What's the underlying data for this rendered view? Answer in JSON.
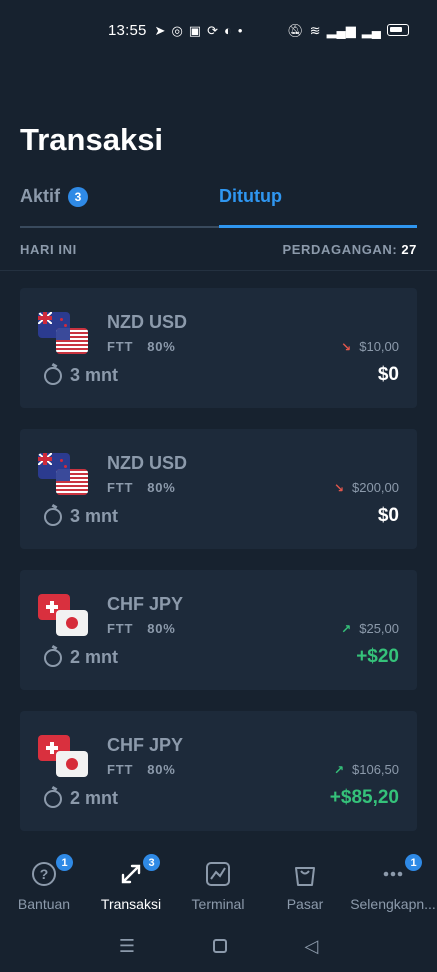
{
  "status_bar": {
    "time": "13:55"
  },
  "header": {
    "title": "Transaksi"
  },
  "tabs": {
    "active_label": "Aktif",
    "active_badge": "3",
    "closed_label": "Ditutup"
  },
  "summary": {
    "left": "HARI INI",
    "right_label": "PERDAGANGAN:",
    "right_count": "27"
  },
  "trades": [
    {
      "pair": "NZD USD",
      "type": "FTT",
      "percent": "80%",
      "direction": "down",
      "amount": "$10,00",
      "duration": "3 mnt",
      "profit": "$0",
      "flags": [
        "nz",
        "us"
      ]
    },
    {
      "pair": "NZD USD",
      "type": "FTT",
      "percent": "80%",
      "direction": "down",
      "amount": "$200,00",
      "duration": "3 mnt",
      "profit": "$0",
      "flags": [
        "nz",
        "us"
      ]
    },
    {
      "pair": "CHF JPY",
      "type": "FTT",
      "percent": "80%",
      "direction": "up",
      "amount": "$25,00",
      "duration": "2 mnt",
      "profit": "+$20",
      "flags": [
        "ch",
        "jp"
      ]
    },
    {
      "pair": "CHF JPY",
      "type": "FTT",
      "percent": "80%",
      "direction": "up",
      "amount": "$106,50",
      "duration": "2 mnt",
      "profit": "+$85,20",
      "flags": [
        "ch",
        "jp"
      ]
    }
  ],
  "bottom_nav": [
    {
      "label": "Bantuan",
      "icon": "help-icon",
      "badge": "1"
    },
    {
      "label": "Transaksi",
      "icon": "transactions-icon",
      "badge": "3"
    },
    {
      "label": "Terminal",
      "icon": "chart-icon",
      "badge": ""
    },
    {
      "label": "Pasar",
      "icon": "shopping-bag-icon",
      "badge": ""
    },
    {
      "label": "Selengkapn...",
      "icon": "more-icon",
      "badge": "1"
    }
  ],
  "colors": {
    "background": "#17222f",
    "card": "#1d2a3a",
    "accent": "#2f96f0",
    "muted": "#8c9aab",
    "positive": "#35c27a",
    "negative": "#e0564c"
  }
}
